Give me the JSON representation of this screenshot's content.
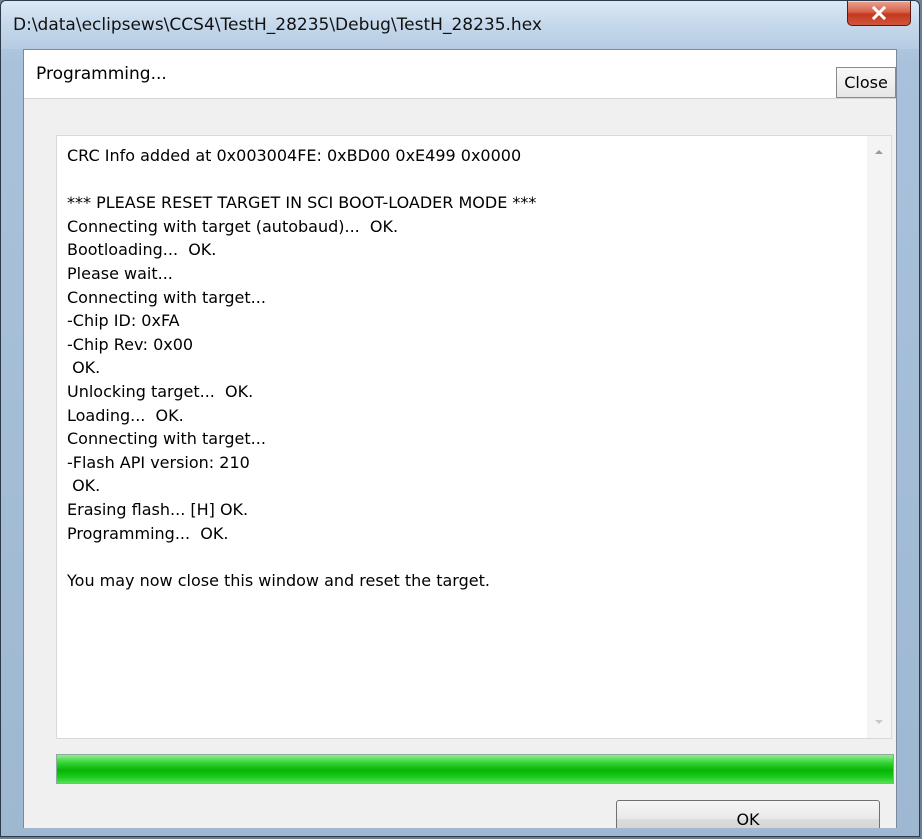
{
  "window": {
    "title": "D:\\data\\eclipsews\\CCS4\\TestH_28235\\Debug\\TestH_28235.hex"
  },
  "status": {
    "text": "Programming...",
    "close_label": "Close"
  },
  "log": {
    "lines": [
      "CRC Info added at 0x003004FE: 0xBD00 0xE499 0x0000",
      "",
      "*** PLEASE RESET TARGET IN SCI BOOT-LOADER MODE ***",
      "Connecting with target (autobaud)...  OK.",
      "Bootloading...  OK.",
      "Please wait...",
      "Connecting with target...",
      "-Chip ID: 0xFA",
      "-Chip Rev: 0x00",
      " OK.",
      "Unlocking target...  OK.",
      "Loading...  OK.",
      "Connecting with target...",
      "-Flash API version: 210",
      " OK.",
      "Erasing flash... [H] OK.",
      "Programming...  OK.",
      "",
      "You may now close this window and reset the target."
    ]
  },
  "progress": {
    "value_percent": 100,
    "color": "#06b406"
  },
  "buttons": {
    "ok_label": "OK"
  },
  "icons": {
    "title_close": "close-icon",
    "scroll_up": "scroll-up-arrow-icon",
    "scroll_down": "scroll-down-arrow-icon"
  }
}
